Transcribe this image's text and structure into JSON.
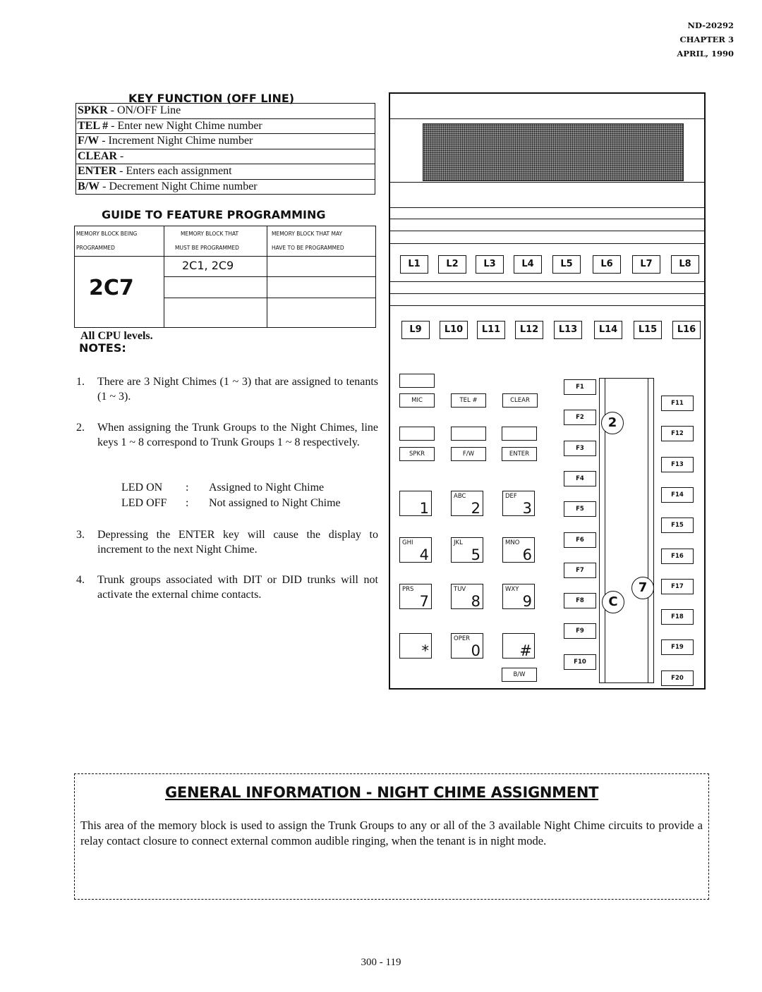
{
  "header": {
    "doc_number": "ND-20292",
    "chapter": "CHAPTER 3",
    "date": "APRIL, 1990"
  },
  "key_function": {
    "title": "KEY FUNCTION (OFF LINE)",
    "rows": [
      {
        "key": "SPKR",
        "desc": " - ON/OFF Line"
      },
      {
        "key": "TEL #",
        "desc": " - Enter new Night Chime number"
      },
      {
        "key": "F/W",
        "desc": " - Increment Night Chime number"
      },
      {
        "key": "CLEAR",
        "desc": " -"
      },
      {
        "key": "ENTER",
        "desc": " - Enters each assignment"
      },
      {
        "key": "B/W",
        "desc": " - Decrement Night Chime number"
      }
    ]
  },
  "guide": {
    "title": "GUIDE TO FEATURE PROGRAMMING",
    "headers": [
      [
        "MEMORY BLOCK BEING",
        "PROGRAMMED"
      ],
      [
        "MEMORY BLOCK THAT",
        "MUST BE PROGRAMMED"
      ],
      [
        "MEMORY BLOCK THAT MAY",
        "HAVE TO BE PROGRAMMED"
      ]
    ],
    "block_programmed": "2C7",
    "must_be_programmed": [
      "2C1, 2C9",
      "",
      ""
    ],
    "may_be_programmed": [
      "",
      "",
      ""
    ]
  },
  "cpu_levels": "All CPU levels.",
  "notes": {
    "title": "NOTES:",
    "items": [
      {
        "num": "1.",
        "text": "There are 3 Night Chimes (1 ~ 3) that are assigned to tenants (1 ~ 3)."
      },
      {
        "num": "2.",
        "text": "When assigning the Trunk Groups to the Night Chimes, line keys 1 ~ 8 correspond to Trunk Groups 1 ~ 8 respectively."
      },
      {
        "num": "3.",
        "text": "Depressing the ENTER key will cause the display to increment to the next Night Chime."
      },
      {
        "num": "4.",
        "text": "Trunk groups associated with DIT or DID trunks will not activate the external chime contacts."
      }
    ],
    "led": [
      {
        "state": "LED ON",
        "sep": ":",
        "meaning": "Assigned to Night Chime"
      },
      {
        "state": "LED OFF",
        "sep": ":",
        "meaning": "Not assigned to Night Chime"
      }
    ]
  },
  "phone": {
    "line_keys_row1": [
      "L1",
      "L2",
      "L3",
      "L4",
      "L5",
      "L6",
      "L7",
      "L8"
    ],
    "line_keys_row2": [
      "L9",
      "L10",
      "L11",
      "L12",
      "L13",
      "L14",
      "L15",
      "L16"
    ],
    "soft_keys": {
      "mic": "MIC",
      "tel": "TEL #",
      "clear": "CLEAR",
      "spkr": "SPKR",
      "fw": "F/W",
      "enter": "ENTER",
      "bw": "B/W"
    },
    "dial_keys": [
      {
        "letters": "",
        "num": "1"
      },
      {
        "letters": "ABC",
        "num": "2"
      },
      {
        "letters": "DEF",
        "num": "3"
      },
      {
        "letters": "GHI",
        "num": "4"
      },
      {
        "letters": "JKL",
        "num": "5"
      },
      {
        "letters": "MNO",
        "num": "6"
      },
      {
        "letters": "PRS",
        "num": "7"
      },
      {
        "letters": "TUV",
        "num": "8"
      },
      {
        "letters": "WXY",
        "num": "9"
      },
      {
        "letters": "",
        "num": "*"
      },
      {
        "letters": "OPER",
        "num": "0"
      },
      {
        "letters": "",
        "num": "#"
      }
    ],
    "function_keys_left": [
      "F1",
      "F2",
      "F3",
      "F4",
      "F5",
      "F6",
      "F7",
      "F8",
      "F9",
      "F10"
    ],
    "function_keys_right": [
      "F11",
      "F12",
      "F13",
      "F14",
      "F15",
      "F16",
      "F17",
      "F18",
      "F19",
      "F20"
    ],
    "callouts": [
      "2",
      "C",
      "7"
    ]
  },
  "general_info": {
    "title": "GENERAL INFORMATION - NIGHT CHIME ASSIGNMENT",
    "body": "This area of the memory block is used to assign the Trunk Groups to any or all of the 3 available Night Chime circuits to provide a relay contact closure to connect external common audible ringing, when the tenant is in night mode."
  },
  "page_number": "300 - 119"
}
